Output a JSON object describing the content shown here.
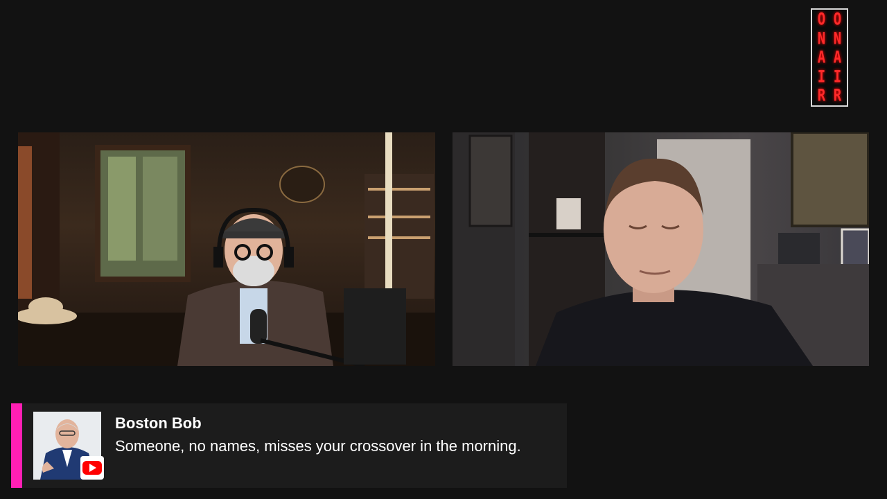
{
  "on_air_sign": {
    "columns": [
      [
        "O",
        "N",
        "A",
        "I",
        "R"
      ],
      [
        "O",
        "N",
        "A",
        "I",
        "R"
      ]
    ],
    "color": "#ff2a2a"
  },
  "video_tiles": [
    {
      "name": "host-video",
      "description_icon": "video-feed"
    },
    {
      "name": "guest-video",
      "description_icon": "video-feed"
    }
  ],
  "comment": {
    "author": "Boston Bob",
    "text": "Someone, no names, misses your crossover in the morning.",
    "accent_color": "#ff1fb4",
    "platform_icon": "youtube-icon",
    "platform_color": "#ff0000"
  }
}
